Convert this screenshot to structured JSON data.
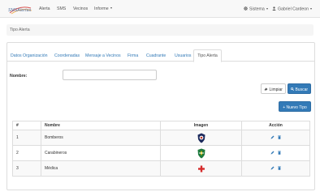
{
  "navbar": {
    "brand": "SMSAlertas",
    "links": [
      "Alerta",
      "SMS",
      "Vecinos"
    ],
    "informe": "Informe",
    "sistema": "Sistema",
    "user": "Gabriel Cardeon"
  },
  "page_header": {
    "title": "Tipo Alerta"
  },
  "tabs": [
    "Datos Organización",
    "Coordenadas",
    "Mensaje a Vecinos",
    "Firma",
    "Cuadrante",
    "Usuarios",
    "Tipo Alerta"
  ],
  "active_tab": "Tipo Alerta",
  "form": {
    "nombre_label": "Nombre:",
    "nombre_value": ""
  },
  "buttons": {
    "limpiar": "Limpiar",
    "buscar": "Buscar",
    "nuevo_tipo": "+ Nuevo Tipo"
  },
  "table": {
    "headers": [
      "#",
      "Nombre",
      "Imagen",
      "Acción"
    ],
    "rows": [
      {
        "num": "1",
        "nombre": "Bomberos",
        "icon": "fire-department-badge-icon"
      },
      {
        "num": "2",
        "nombre": "Carabineros",
        "icon": "police-shield-icon"
      },
      {
        "num": "3",
        "nombre": "Médica",
        "icon": "red-cross-icon"
      }
    ]
  },
  "colors": {
    "primary": "#337ab7",
    "link": "#337ab7",
    "edit": "#337ab7",
    "delete": "#337ab7"
  }
}
